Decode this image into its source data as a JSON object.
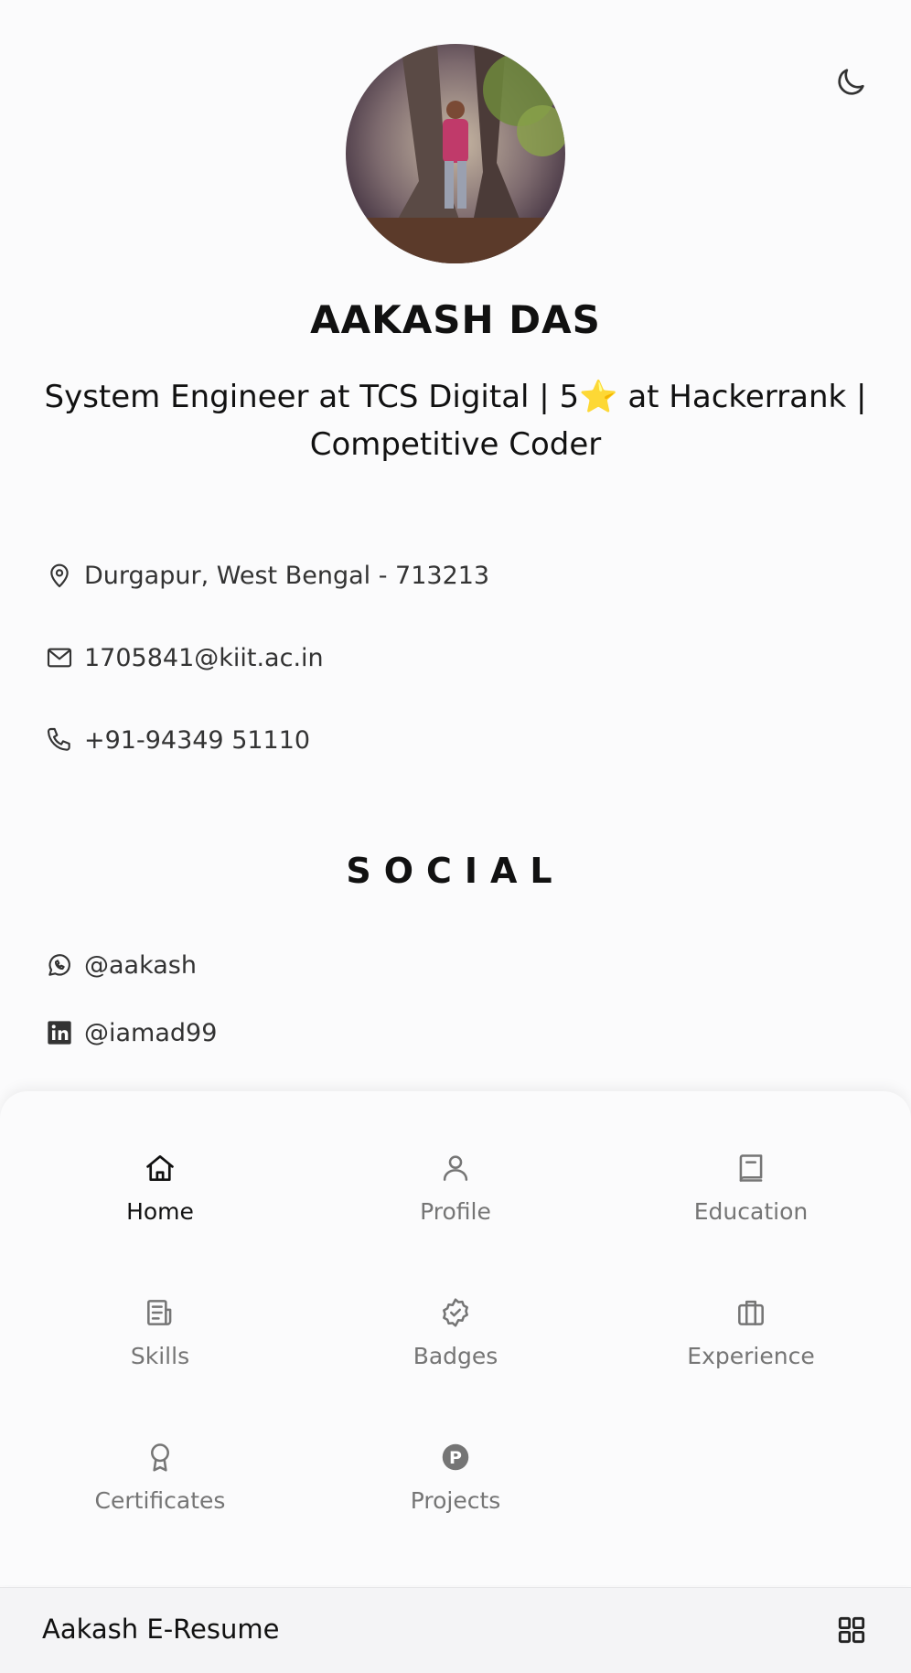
{
  "profile": {
    "name": "AAKASH DAS",
    "headline": "System Engineer at TCS Digital | 5⭐ at Hackerrank | Competitive Coder"
  },
  "contact": [
    {
      "icon": "location-pin-icon",
      "text": "Durgapur, West Bengal - 713213"
    },
    {
      "icon": "mail-icon",
      "text": "1705841@kiit.ac.in"
    },
    {
      "icon": "phone-icon",
      "text": "+91-94349 51110"
    }
  ],
  "social": {
    "title": "SOCIAL",
    "items": [
      {
        "icon": "whatsapp-icon",
        "text": "@aakash"
      },
      {
        "icon": "linkedin-icon",
        "text": "@iamad99"
      }
    ]
  },
  "menu": {
    "items": [
      {
        "label": "Home",
        "icon": "home-icon",
        "active": true
      },
      {
        "label": "Profile",
        "icon": "user-icon",
        "active": false
      },
      {
        "label": "Education",
        "icon": "book-icon",
        "active": false
      },
      {
        "label": "Skills",
        "icon": "document-icon",
        "active": false
      },
      {
        "label": "Badges",
        "icon": "badge-check-icon",
        "active": false
      },
      {
        "label": "Experience",
        "icon": "briefcase-icon",
        "active": false
      },
      {
        "label": "Certificates",
        "icon": "award-icon",
        "active": false
      },
      {
        "label": "Projects",
        "icon": "projects-p-icon",
        "active": false
      }
    ]
  },
  "bottom_bar": {
    "title": "Aakash E-Resume",
    "grid_icon": "grid-icon"
  },
  "colors": {
    "accent": "#111111",
    "muted": "#757575",
    "background": "#fbfbfc"
  }
}
